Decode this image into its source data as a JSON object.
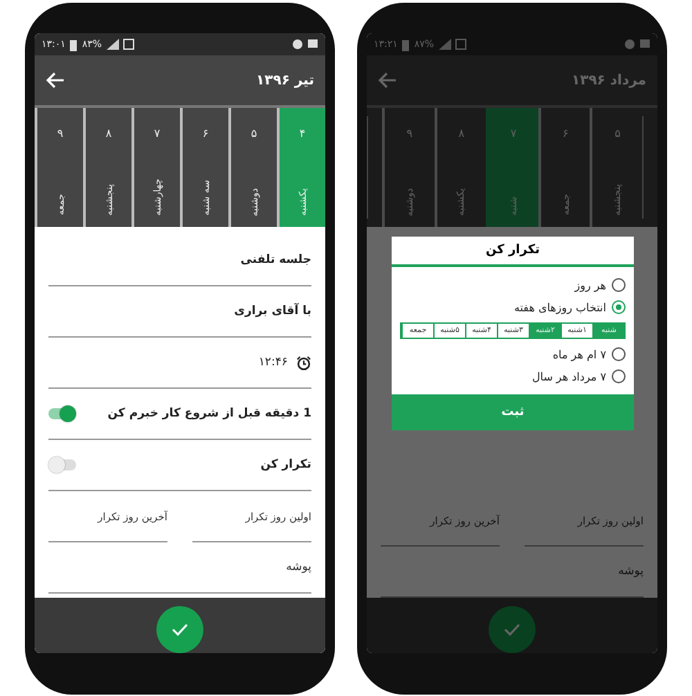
{
  "phones": [
    {
      "status_bar": {
        "time": "۱۳:۰۱",
        "battery": "۸۳%"
      },
      "toolbar": {
        "title": "تیر ۱۳۹۶"
      },
      "days": [
        {
          "number": "۴",
          "name": "یکشنبه",
          "selected": true
        },
        {
          "number": "۵",
          "name": "دوشنبه",
          "selected": false
        },
        {
          "number": "۶",
          "name": "سه شنبه",
          "selected": false
        },
        {
          "number": "۷",
          "name": "چهارشنبه",
          "selected": false
        },
        {
          "number": "۸",
          "name": "پنجشنبه",
          "selected": false
        },
        {
          "number": "۹",
          "name": "جمعه",
          "selected": false
        }
      ],
      "form": [
        {
          "kind": "text",
          "value": "جلسه تلفنی"
        },
        {
          "kind": "text",
          "value": "با آقای براری"
        },
        {
          "kind": "time",
          "value": "۱۲:۴۶"
        },
        {
          "kind": "toggle",
          "label": "1 دقیقه قبل از شروع کار خبرم کن",
          "on": true
        },
        {
          "kind": "toggle",
          "label": "تکرار کن",
          "on": false
        },
        {
          "kind": "pair",
          "placeholders": [
            "اولین روز تکرار",
            "آخرین روز تکرار"
          ]
        },
        {
          "kind": "text",
          "placeholder": "پوشه"
        }
      ]
    },
    {
      "status_bar": {
        "time": "۱۳:۲۱",
        "battery": "۸۷%"
      },
      "toolbar": {
        "title": "مرداد ۱۳۹۶"
      },
      "days": [
        {
          "number": "۵",
          "name": "پنجشنبه",
          "selected": false
        },
        {
          "number": "۶",
          "name": "جمعه",
          "selected": false
        },
        {
          "number": "۷",
          "name": "شنبه",
          "selected": true
        },
        {
          "number": "۸",
          "name": "یکشنبه",
          "selected": false
        },
        {
          "number": "۹",
          "name": "دوشنبه",
          "selected": false
        }
      ],
      "form": [
        {
          "kind": "pair",
          "placeholders": [
            "اولین روز تکرار",
            "آخرین روز تکرار"
          ]
        },
        {
          "kind": "text",
          "placeholder": "پوشه"
        }
      ],
      "dialog": {
        "title": "تکرار کن",
        "options": [
          {
            "label": "هر روز",
            "selected": false
          },
          {
            "label": "انتخاب روزهای هفته",
            "selected": true,
            "weekdays": [
              {
                "label": "شنبه",
                "selected": true
              },
              {
                "label": "۱شنبه",
                "selected": false
              },
              {
                "label": "۲شنبه",
                "selected": true
              },
              {
                "label": "۳شنبه",
                "selected": false
              },
              {
                "label": "۴شنبه",
                "selected": false
              },
              {
                "label": "۵شنبه",
                "selected": false
              },
              {
                "label": "جمعه",
                "selected": false
              }
            ]
          },
          {
            "label": "۷ ام هر ماه",
            "selected": false
          },
          {
            "label": "۷ مرداد هر سال",
            "selected": false
          }
        ],
        "button": "ثبت"
      }
    }
  ]
}
